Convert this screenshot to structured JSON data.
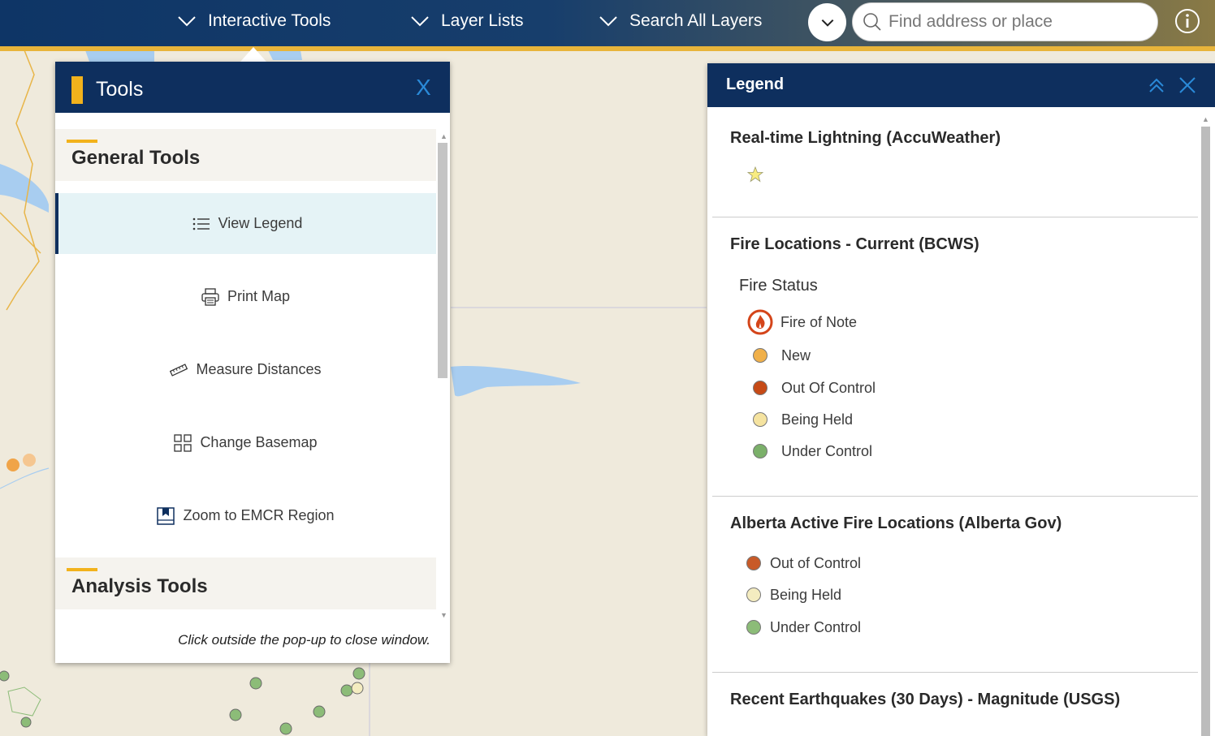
{
  "nav": {
    "items": [
      {
        "label": "Interactive Tools"
      },
      {
        "label": "Layer Lists"
      },
      {
        "label": "Search All Layers"
      }
    ],
    "search_placeholder": "Find address or place"
  },
  "tools_panel": {
    "title": "Tools",
    "close_label": "X",
    "general_title": "General Tools",
    "items": [
      {
        "label": "View Legend",
        "icon": "list-icon"
      },
      {
        "label": "Print Map",
        "icon": "printer-icon"
      },
      {
        "label": "Measure Distances",
        "icon": "ruler-icon"
      },
      {
        "label": "Change Basemap",
        "icon": "grid-icon"
      },
      {
        "label": "Zoom to EMCR Region",
        "icon": "bookmark-icon"
      }
    ],
    "analysis_title": "Analysis Tools",
    "footer": "Click outside the pop-up to close window."
  },
  "legend": {
    "title": "Legend",
    "sections": [
      {
        "title": "Real-time Lightning (AccuWeather)"
      },
      {
        "title": "Fire Locations - Current (BCWS)",
        "subtitle": "Fire Status",
        "items": [
          {
            "label": "Fire of Note",
            "color": "#d4451a"
          },
          {
            "label": "New",
            "color": "#f0b04a"
          },
          {
            "label": "Out Of Control",
            "color": "#c64a16"
          },
          {
            "label": "Being Held",
            "color": "#f5e3a0"
          },
          {
            "label": "Under Control",
            "color": "#7bb06a"
          }
        ]
      },
      {
        "title": "Alberta Active Fire Locations (Alberta Gov)",
        "items": [
          {
            "label": "Out of Control",
            "color": "#c85a28"
          },
          {
            "label": "Being Held",
            "color": "#f4ecc0"
          },
          {
            "label": "Under Control",
            "color": "#8cbc78"
          }
        ]
      },
      {
        "title": "Recent Earthquakes (30 Days) - Magnitude (USGS)"
      }
    ]
  }
}
